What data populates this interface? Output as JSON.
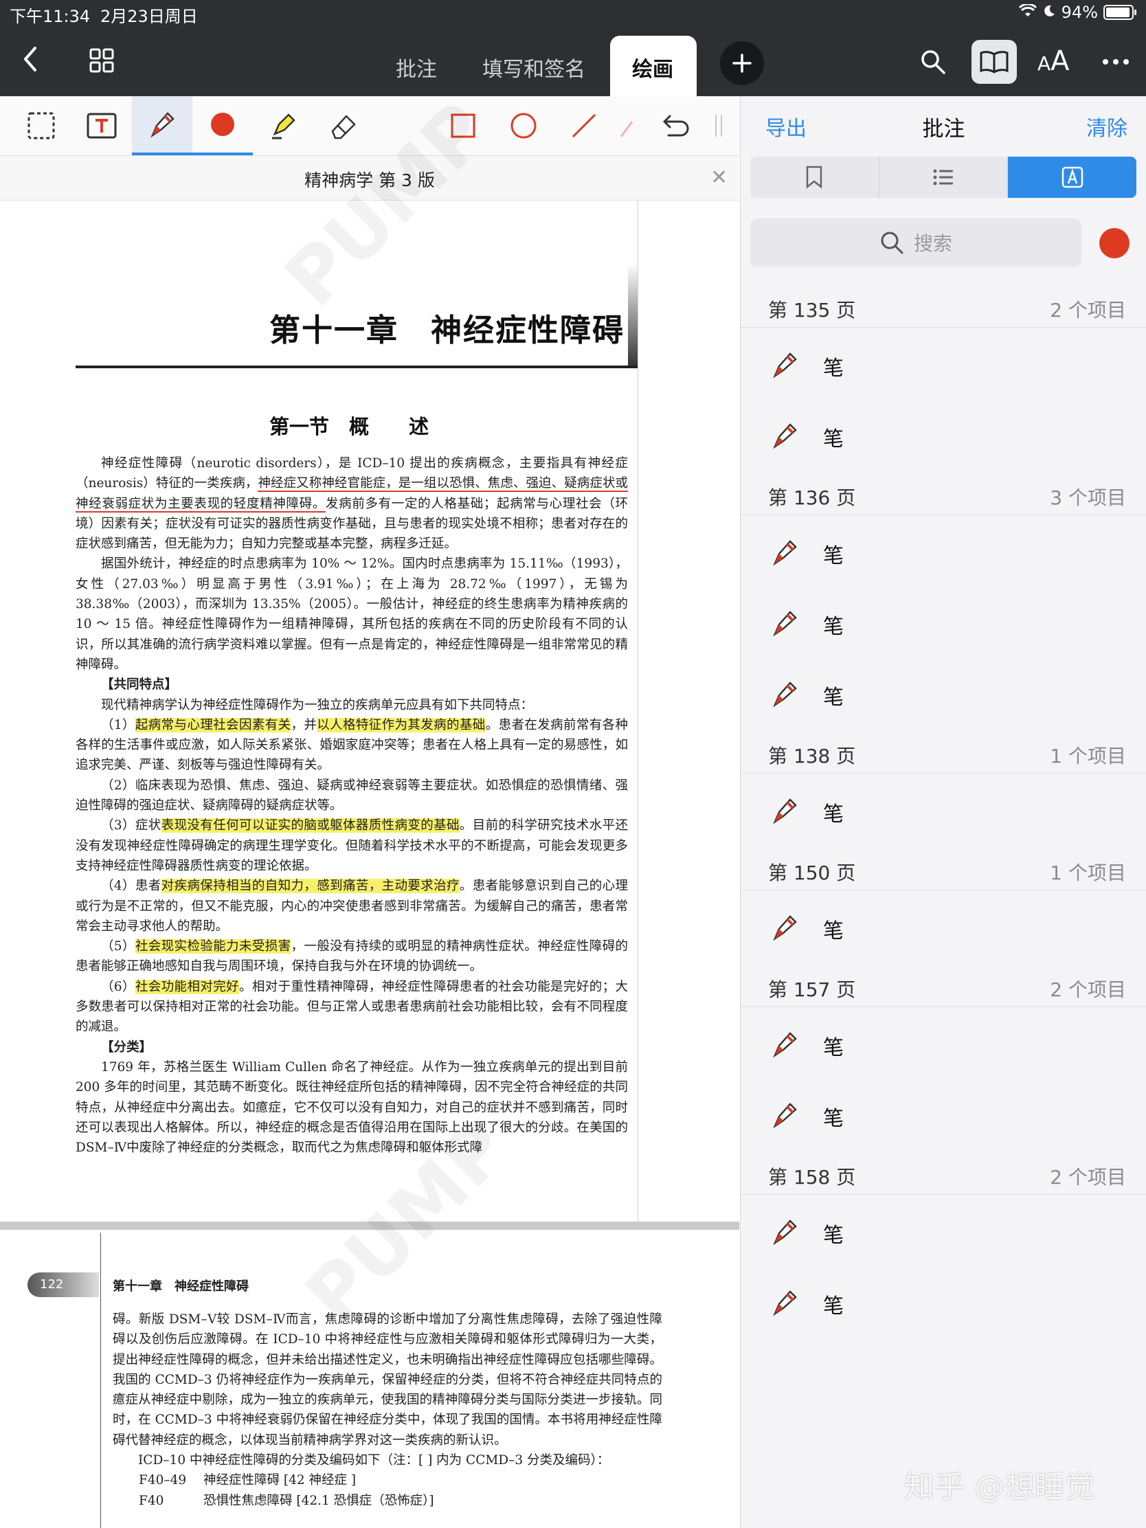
{
  "status_bar": {
    "time": "下午11:34",
    "date": "2月23日周日",
    "battery": "94%",
    "battery_level": 0.94
  },
  "nav": {
    "tabs": [
      "批注",
      "填写和签名",
      "绘画"
    ],
    "active_tab": "绘画",
    "font_button": "AA"
  },
  "toolbar": {
    "tools": [
      "selection-tool",
      "text-tool",
      "pen-tool",
      "color-red",
      "highlighter-tool",
      "eraser-tool",
      "rectangle-tool",
      "ellipse-tool",
      "line-tool",
      "arrow-tool",
      "undo",
      "more"
    ],
    "active_color": "#dd3a22"
  },
  "document": {
    "title": "精神病学 第 3 版",
    "chapter_title": "第十一章　神经症性障碍",
    "section_title": "第一节　概　　述",
    "p1_a": "神经症性障碍（neurotic disorders），是 ICD–10 提出的疾病概念，主要指具有神经症（neurosis）特征的一类疾病，",
    "p1_ul": "神经症又称神经官能症，是一组以恐惧、焦虑、强迫、疑病症状或神经衰弱症状为主要表现的轻度精神障碍。",
    "p1_b": "发病前多有一定的人格基础；起病常与心理社会（环境）因素有关；症状没有可证实的器质性病变作基础，且与患者的现实处境不相称；患者对存在的症状感到痛苦，但无能为力；自知力完整或基本完整，病程多迁延。",
    "p2": "据国外统计，神经症的时点患病率为 10% ～ 12%。国内时点患病率为 15.11‰（1993），女性（27.03‰）明显高于男性（3.91‰）；在上海为 28.72‰（1997），无锡为 38.38‰（2003），而深圳为 13.35%（2005）。一般估计，神经症的终生患病率为精神疾病的 10 ～ 15 倍。神经症性障碍作为一组精神障碍，其所包括的疾病在不同的历史阶段有不同的认识，所以其准确的流行病学资料难以掌握。但有一点是肯定的，神经症性障碍是一组非常常见的精神障碍。",
    "h_common": "【共同特点】",
    "p3": "现代精神病学认为神经症性障碍作为一独立的疾病单元应具有如下共同特点：",
    "f1_pre": "（1）",
    "f1_hl1": "起病常与心理社会因素有关",
    "f1_mid": "，并",
    "f1_hl2": "以人格特征作为其发病的基础",
    "f1_post": "。患者在发病前常有各种各样的生活事件或应激，如人际关系紧张、婚姻家庭冲突等；患者在人格上具有一定的易感性，如追求完美、严谨、刻板等与强迫性障碍有关。",
    "f2": "（2）临床表现为恐惧、焦虑、强迫、疑病或神经衰弱等主要症状。如恐惧症的恐惧情绪、强迫性障碍的强迫症状、疑病障碍的疑病症状等。",
    "f3_pre": "（3）症状",
    "f3_hl": "表现没有任何可以证实的脑或躯体器质性病变的基础",
    "f3_post": "。目前的科学研究技术水平还没有发现神经症性障碍确定的病理生理学变化。但随着科学技术水平的不断提高，可能会发现更多支持神经症性障碍器质性病变的理论依据。",
    "f4_pre": "（4）患者",
    "f4_hl": "对疾病保持相当的自知力，感到痛苦，主动要求治疗",
    "f4_post": "。患者能够意识到自己的心理或行为是不正常的，但又不能克服，内心的冲突使患者感到非常痛苦。为缓解自己的痛苦，患者常常会主动寻求他人的帮助。",
    "f5_pre": "（5）",
    "f5_hl": "社会现实检验能力未受损害",
    "f5_post": "，一般没有持续的或明显的精神病性症状。神经症性障碍的患者能够正确地感知自我与周围环境，保持自我与外在环境的协调统一。",
    "f6_pre": "（6）",
    "f6_hl": "社会功能相对完好",
    "f6_post": "。相对于重性精神障碍，神经症性障碍患者的社会功能是完好的；大多数患者可以保持相对正常的社会功能。但与正常人或患者患病前社会功能相比较，会有不同程度的减退。",
    "h_class": "【分类】",
    "p4": "1769 年，苏格兰医生 William Cullen 命名了神经症。从作为一独立疾病单元的提出到目前 200 多年的时间里，其范畴不断变化。既往神经症所包括的精神障碍，因不完全符合神经症的共同特点，从神经症中分离出去。如癔症，它不仅可以没有自知力，对自己的症状并不感到痛苦，同时还可以表现出人格解体。所以，神经症的概念是否值得沿用在国际上出现了很大的分歧。在美国的 DSM–Ⅳ中废除了神经症的分类概念，取而代之为焦虑障碍和躯体形式障",
    "page_number": "122",
    "running_head": "第十一章　神经症性障碍",
    "p5": "碍。新版 DSM–Ⅴ较 DSM–Ⅳ而言，焦虑障碍的诊断中增加了分离性焦虑障碍，去除了强迫性障碍以及创伤后应激障碍。在 ICD–10 中将神经症性与应激相关障碍和躯体形式障碍归为一大类，提出神经症性障碍的概念，但并未给出描述性定义，也未明确指出神经症性障碍应包括哪些障碍。我国的 CCMD–3 仍将神经症作为一疾病单元，保留神经症的分类，但将不符合神经症共同特点的癔症从神经症中剔除，成为一独立的疾病单元，使我国的精神障碍分类与国际分类进一步接轨。同时，在 CCMD–3 中将神经衰弱仍保留在神经症分类中，体现了我国的国情。本书将用神经症性障碍代替神经症的概念，以体现当前精神病学界对这一类疾病的新认识。",
    "p6": "ICD–10 中神经症性障碍的分类及编码如下（注：[ ] 内为 CCMD–3 分类及编码）：",
    "codes": [
      {
        "code": "F40–49",
        "name": "神经症性障碍 [42 神经症 ]"
      },
      {
        "code": "F40",
        "name": "恐惧性焦虑障碍 [42.1 恐惧症（恐怖症）]"
      }
    ],
    "watermark": "PUMP",
    "brand_watermark": "知乎 @想睡觉"
  },
  "panel": {
    "export_label": "导出",
    "title": "批注",
    "clear_label": "清除",
    "search_placeholder": "搜索",
    "groups": [
      {
        "page": "第 135 页",
        "count": "2 个项目",
        "items": [
          "笔",
          "笔"
        ]
      },
      {
        "page": "第 136 页",
        "count": "3 个项目",
        "items": [
          "笔",
          "笔",
          "笔"
        ]
      },
      {
        "page": "第 138 页",
        "count": "1 个项目",
        "items": [
          "笔"
        ]
      },
      {
        "page": "第 150 页",
        "count": "1 个项目",
        "items": [
          "笔"
        ]
      },
      {
        "page": "第 157 页",
        "count": "2 个项目",
        "items": [
          "笔",
          "笔"
        ]
      },
      {
        "page": "第 158 页",
        "count": "2 个项目",
        "items": [
          "笔",
          "笔"
        ]
      }
    ]
  }
}
